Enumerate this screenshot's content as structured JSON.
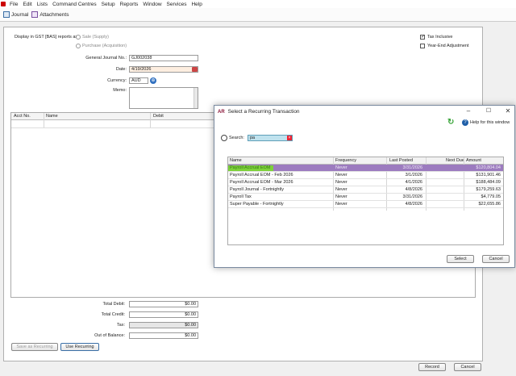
{
  "menu": [
    "File",
    "Edit",
    "Lists",
    "Command Centres",
    "Setup",
    "Reports",
    "Window",
    "Services",
    "Help"
  ],
  "toolbar": {
    "journal": "Journal",
    "attachments": "Attachments"
  },
  "form": {
    "gst_label": "Display in GST [BAS] reports as:",
    "sale": "Sale (Supply)",
    "purchase": "Purchase (Acquisition)",
    "journal_no_label": "General Journal No.:",
    "journal_no": "GJ002038",
    "date_label": "Date:",
    "date": "4/19/2026",
    "currency_label": "Currency:",
    "currency": "AUD",
    "memo_label": "Memo:",
    "tax_inclusive": "Tax Inclusive",
    "year_end": "Year-End Adjustment"
  },
  "grid": {
    "acct": "Acct No.",
    "name": "Name",
    "debit": "Debit"
  },
  "totals": {
    "debit_label": "Total Debit:",
    "debit": "$0.00",
    "credit_label": "Total Credit:",
    "credit": "$0.00",
    "tax_label": "Tax:",
    "tax": "$0.00",
    "oob_label": "Out of Balance:",
    "oob": "$0.00"
  },
  "buttons": {
    "save_recurring": "Save as Recurring",
    "use_recurring": "Use Recurring",
    "record": "Record",
    "cancel": "Cancel"
  },
  "dialog": {
    "logo": "AR",
    "title": "Select a Recurring Transaction",
    "help": "Help for this window",
    "search_label": "Search:",
    "search_value": "pa",
    "columns": [
      "Name",
      "Frequency",
      "Last Posted",
      "Next Due",
      "Amount"
    ],
    "rows": [
      {
        "name": "Payroll Accrual EOM",
        "freq": "Never",
        "last": "3/31/2026",
        "next": "",
        "amount": "$120,804.04"
      },
      {
        "name": "Payroll Accrual EOM - Feb 2026",
        "freq": "Never",
        "last": "3/1/2026",
        "next": "",
        "amount": "$131,901.46"
      },
      {
        "name": "Payroll Accrual EOM - Mar 2026",
        "freq": "Never",
        "last": "4/1/2026",
        "next": "",
        "amount": "$188,484.09"
      },
      {
        "name": "Payroll Journal - Fortnightly",
        "freq": "Never",
        "last": "4/8/2026",
        "next": "",
        "amount": "$179,259.63"
      },
      {
        "name": "Payroll Tax",
        "freq": "Never",
        "last": "3/31/2026",
        "next": "",
        "amount": "$4,779.05"
      },
      {
        "name": "Super Payable - Fortnightly",
        "freq": "Never",
        "last": "4/8/2026",
        "next": "",
        "amount": "$22,655.86"
      }
    ],
    "select": "Select",
    "cancel": "Cancel"
  },
  "colors": {
    "selected_row": "#9c7bbf",
    "highlight": "#7dd13a",
    "brand": "#8a1538"
  }
}
